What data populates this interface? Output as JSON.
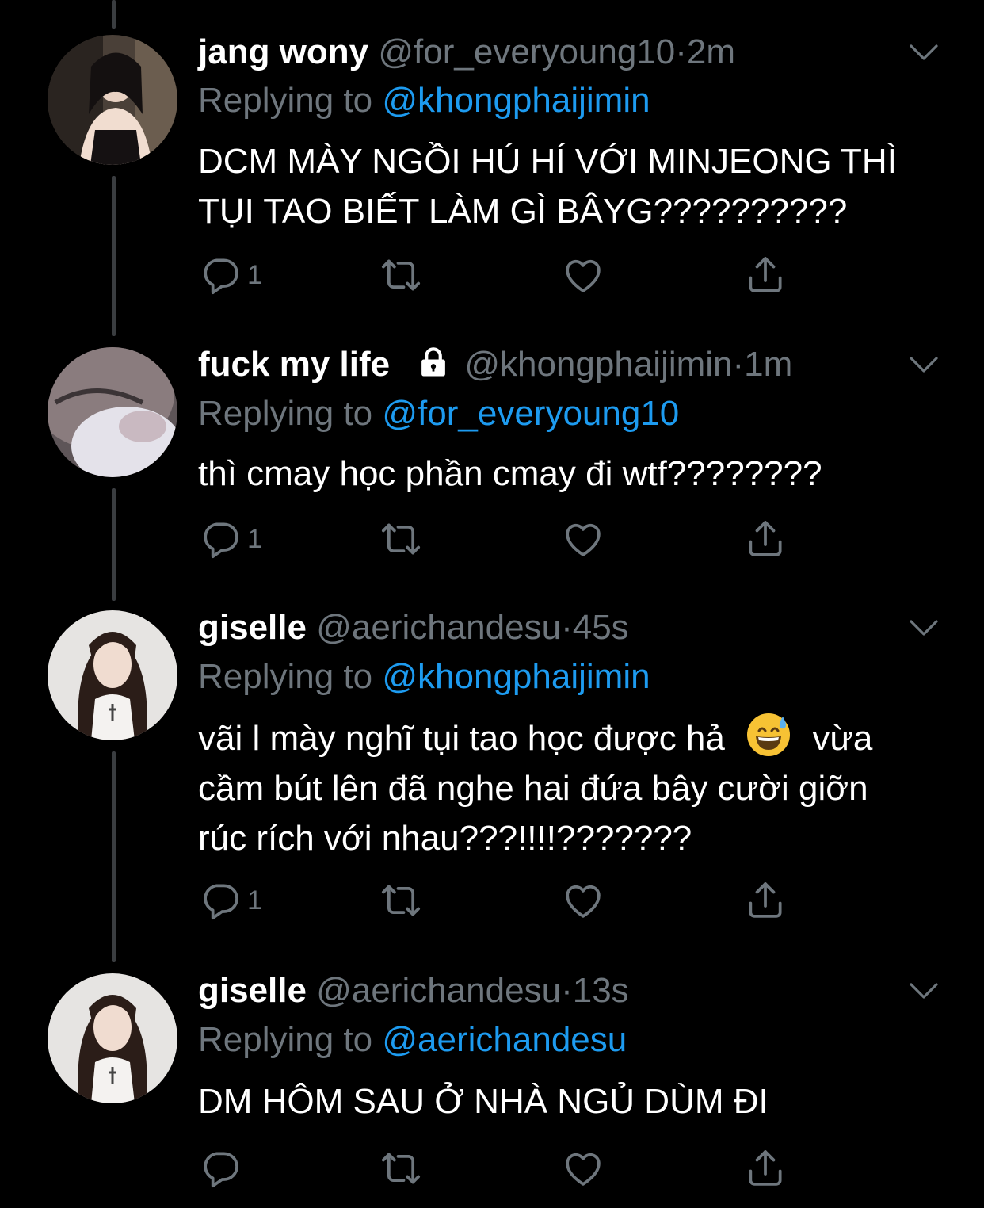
{
  "tweets": [
    {
      "name": "jang wony",
      "handle": "@for_everyoung10",
      "dot": "·",
      "time": "2m",
      "replying_prefix": "Replying to",
      "replying_to": "@khongphaijimin",
      "text_lines": [
        "DCM MÀY NGỒI HÚ HÍ VỚI MINJEONG THÌ",
        "TỤI TAO BIẾT LÀM GÌ BÂYG??????????"
      ],
      "reply_count": "1",
      "locked": false
    },
    {
      "name": "fuck my life",
      "handle": "@khongphaijimin",
      "dot": "·",
      "time": "1m",
      "replying_prefix": "Replying to",
      "replying_to": "@for_everyoung10",
      "text_lines": [
        "thì cmay học phần cmay đi wtf????????"
      ],
      "reply_count": "1",
      "locked": true
    },
    {
      "name": "giselle",
      "handle": "@aerichandesu",
      "dot": "·",
      "time": "45s",
      "replying_prefix": "Replying to",
      "replying_to": "@khongphaijimin",
      "text_line1_a": "vãi l mày nghĩ tụi tao học được hả",
      "text_line1_emoji": "grinning-face-with-sweat-emoji",
      "text_line1_b": "vừa",
      "text_line2": "cầm bút lên đã nghe hai đứa bây cười giỡn",
      "text_line3": "rúc rích với nhau???!!!!???????",
      "reply_count": "1",
      "locked": false
    },
    {
      "name": "giselle",
      "handle": "@aerichandesu",
      "dot": "·",
      "time": "13s",
      "replying_prefix": "Replying to",
      "replying_to": "@aerichandesu",
      "text_lines": [
        "DM HÔM SAU Ở NHÀ NGỦ DÙM ĐI"
      ],
      "reply_count": "",
      "locked": false
    }
  ],
  "icons": {
    "reply": "reply-icon",
    "retweet": "retweet-icon",
    "like": "like-icon",
    "share": "share-icon",
    "more": "chevron-down-icon",
    "lock": "lock-icon"
  },
  "colors": {
    "background": "#000000",
    "text": "#ffffff",
    "secondary": "#6e767d",
    "mention": "#1d9bf0",
    "thread_line": "#3a3d40"
  }
}
